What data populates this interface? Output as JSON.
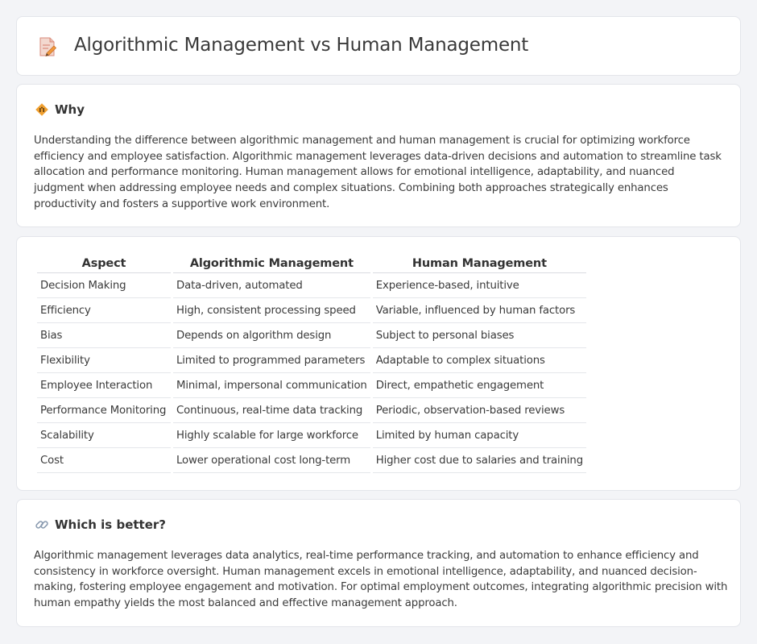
{
  "header": {
    "title": "Algorithmic Management vs Human Management",
    "icon": "document-pen-icon"
  },
  "why": {
    "title": "Why",
    "icon": "warning-sign-icon",
    "text": "Understanding the difference between algorithmic management and human management is crucial for optimizing workforce efficiency and employee satisfaction. Algorithmic management leverages data-driven decisions and automation to streamline task allocation and performance monitoring. Human management allows for emotional intelligence, adaptability, and nuanced judgment when addressing employee needs and complex situations. Combining both approaches strategically enhances productivity and fosters a supportive work environment."
  },
  "table": {
    "headers": [
      "Aspect",
      "Algorithmic Management",
      "Human Management"
    ],
    "rows": [
      [
        "Decision Making",
        "Data-driven, automated",
        "Experience-based, intuitive"
      ],
      [
        "Efficiency",
        "High, consistent processing speed",
        "Variable, influenced by human factors"
      ],
      [
        "Bias",
        "Depends on algorithm design",
        "Subject to personal biases"
      ],
      [
        "Flexibility",
        "Limited to programmed parameters",
        "Adaptable to complex situations"
      ],
      [
        "Employee Interaction",
        "Minimal, impersonal communication",
        "Direct, empathetic engagement"
      ],
      [
        "Performance Monitoring",
        "Continuous, real-time data tracking",
        "Periodic, observation-based reviews"
      ],
      [
        "Scalability",
        "Highly scalable for large workforce",
        "Limited by human capacity"
      ],
      [
        "Cost",
        "Lower operational cost long-term",
        "Higher cost due to salaries and training"
      ]
    ]
  },
  "better": {
    "title": "Which is better?",
    "icon": "link-icon",
    "text": "Algorithmic management leverages data analytics, real-time performance tracking, and automation to enhance efficiency and consistency in workforce oversight. Human management excels in emotional intelligence, adaptability, and nuanced decision-making, fostering employee engagement and motivation. For optimal employment outcomes, integrating algorithmic precision with human empathy yields the most balanced and effective management approach."
  },
  "colors": {
    "background": "#f3f4f7",
    "card": "#ffffff",
    "border": "#e3e5ea",
    "icon_accent": "#f0a030"
  }
}
